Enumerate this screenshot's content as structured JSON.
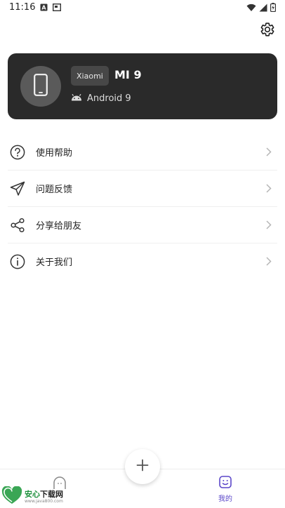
{
  "status_bar": {
    "time": "11:16",
    "icons": [
      "a-notification-icon",
      "picture-notification-icon",
      "wifi-icon",
      "signal-icon",
      "battery-charging-icon"
    ]
  },
  "settings": {
    "icon": "gear-icon"
  },
  "device": {
    "brand": "Xiaomi",
    "model": "MI 9",
    "os": "Android 9",
    "avatar_icon": "smartphone-icon",
    "os_icon": "android-icon"
  },
  "menu": {
    "items": [
      {
        "label": "使用帮助",
        "icon": "help-circle-icon"
      },
      {
        "label": "问题反馈",
        "icon": "send-icon"
      },
      {
        "label": "分享给朋友",
        "icon": "share-icon"
      },
      {
        "label": "关于我们",
        "icon": "info-circle-icon"
      }
    ]
  },
  "bottom_nav": {
    "fab_icon": "plus-icon",
    "home_icon": "home-icon",
    "mine_label": "我的",
    "mine_icon": "face-icon",
    "active_color": "#5b47c9"
  },
  "watermark": {
    "title_green": "安心",
    "title_black": "下载网",
    "url": "www.java800.com"
  },
  "colors": {
    "card_bg": "#2a2a2a",
    "accent": "#5b47c9"
  }
}
